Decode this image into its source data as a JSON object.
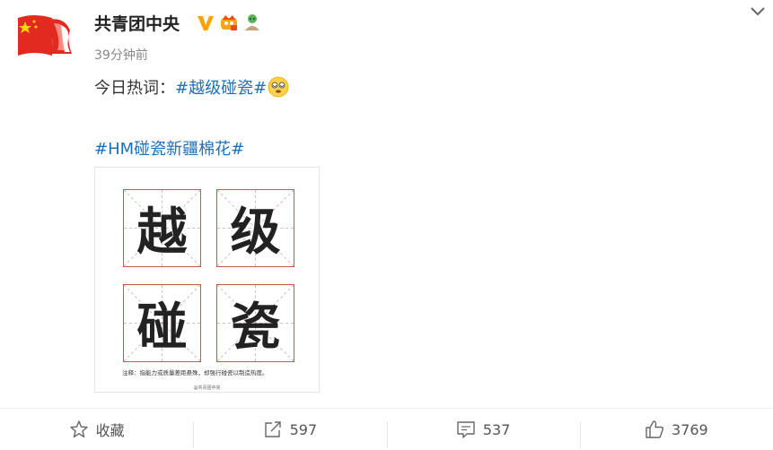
{
  "post": {
    "author": "共青团中央",
    "time": "39分钟前",
    "line1_prefix": "今日热词：",
    "line1_tag": "#越级碰瓷#",
    "line2_tag": "#HM碰瓷新疆棉花#"
  },
  "image": {
    "chars": [
      "越",
      "级",
      "碰",
      "瓷"
    ],
    "note": "注释：指能力或质量差距悬殊，却强行碰瓷以制造热度。",
    "credit": "@共青团中央"
  },
  "actions": {
    "favorite_label": "收藏",
    "repost_count": "597",
    "comment_count": "537",
    "like_count": "3769"
  },
  "colors": {
    "tag": "#1e6fb7",
    "verified": "#ffa200",
    "grid_border": "#c45a4a"
  }
}
